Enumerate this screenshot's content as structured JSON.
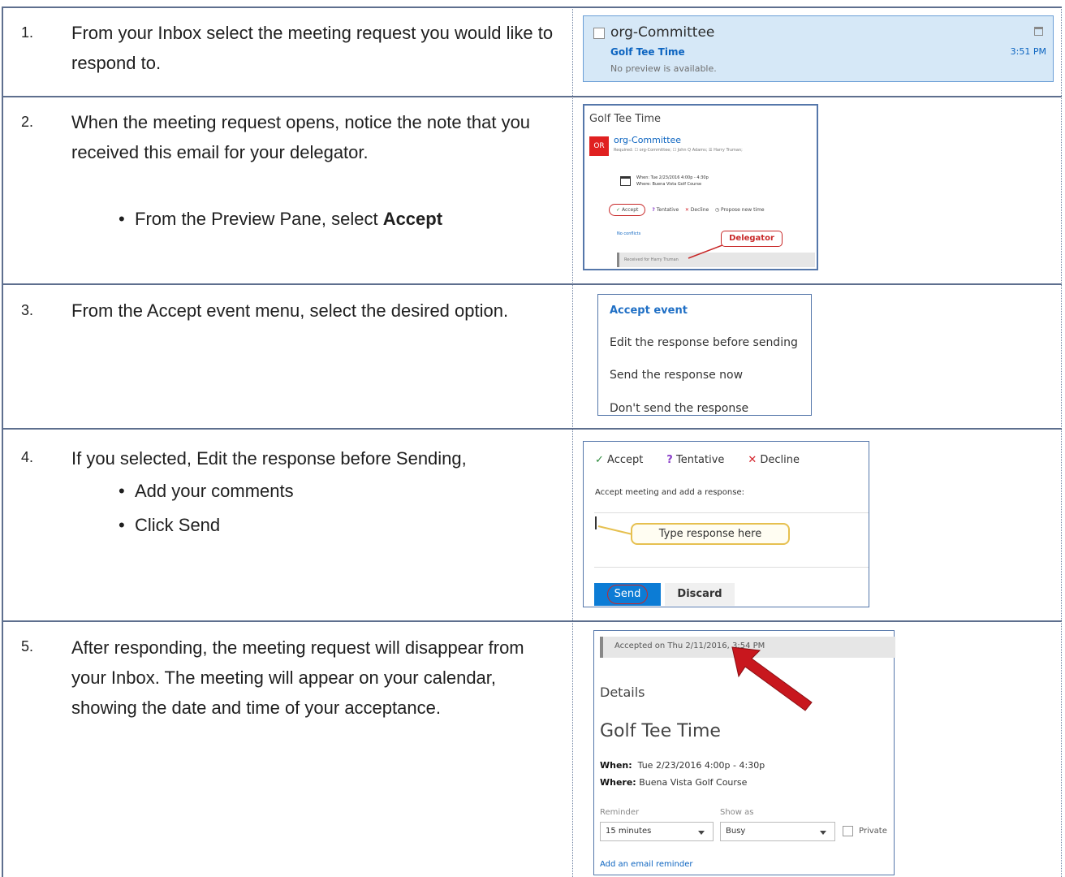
{
  "steps": [
    {
      "number": "1.",
      "text": "From your Inbox select the meeting request you would like to respond to."
    },
    {
      "number": "2.",
      "text": "When the meeting request opens, notice the note that you received this email for your delegator.",
      "bullet_prefix": "From the Preview Pane, select ",
      "bullet_bold": "Accept"
    },
    {
      "number": "3.",
      "text": "From the Accept event menu, select the desired option."
    },
    {
      "number": "4.",
      "text": "If you selected, Edit the response before Sending,",
      "bullets": [
        "Add your comments",
        "Click Send"
      ]
    },
    {
      "number": "5.",
      "text": "After responding, the meeting request will disappear from your Inbox. The meeting will appear on your calendar, showing the date and time of your acceptance."
    }
  ],
  "inbox_item": {
    "from": "org-Committee",
    "subject": "Golf Tee Time",
    "preview": "No preview is available.",
    "time": "3:51 PM"
  },
  "preview_pane": {
    "title": "Golf Tee Time",
    "avatar_initials": "OR",
    "sender": "org-Committee",
    "required": "Required: ☐ org-Committee; ☐ John Q Adams; ☰ Harry Truman;",
    "when": "When:  Tue 2/23/2016 4:00p - 4:30p",
    "where": "Where:  Buena Vista Golf Course",
    "accept": "Accept",
    "tentative": "Tentative",
    "decline": "Decline",
    "propose": "Propose new time",
    "no_conflicts": "No conflicts",
    "delegator_callout": "Delegator",
    "received_for": "Received for Harry Truman"
  },
  "accept_menu": {
    "header": "Accept event",
    "items": [
      "Edit the response before sending",
      "Send the response now",
      "Don't send the response"
    ]
  },
  "response_form": {
    "accept": "Accept",
    "tentative": "Tentative",
    "decline": "Decline",
    "prompt": "Accept meeting and add a response:",
    "callout": "Type response here",
    "send": "Send",
    "discard": "Discard"
  },
  "event_details": {
    "accepted_on": "Accepted on Thu 2/11/2016, 3:54 PM",
    "heading": "Details",
    "title": "Golf Tee Time",
    "when_label": "When:",
    "when_value": "Tue 2/23/2016 4:00p - 4:30p",
    "where_label": "Where:",
    "where_value": "Buena Vista Golf Course",
    "reminder_label": "Reminder",
    "reminder_value": "15 minutes",
    "show_as_label": "Show as",
    "show_as_value": "Busy",
    "private_label": "Private",
    "email_reminder_link": "Add an email reminder"
  },
  "colors": {
    "border": "#5e6f8e",
    "link_blue": "#0c64c0",
    "callout_red": "#c82828",
    "send_blue": "#0c7cd5"
  }
}
